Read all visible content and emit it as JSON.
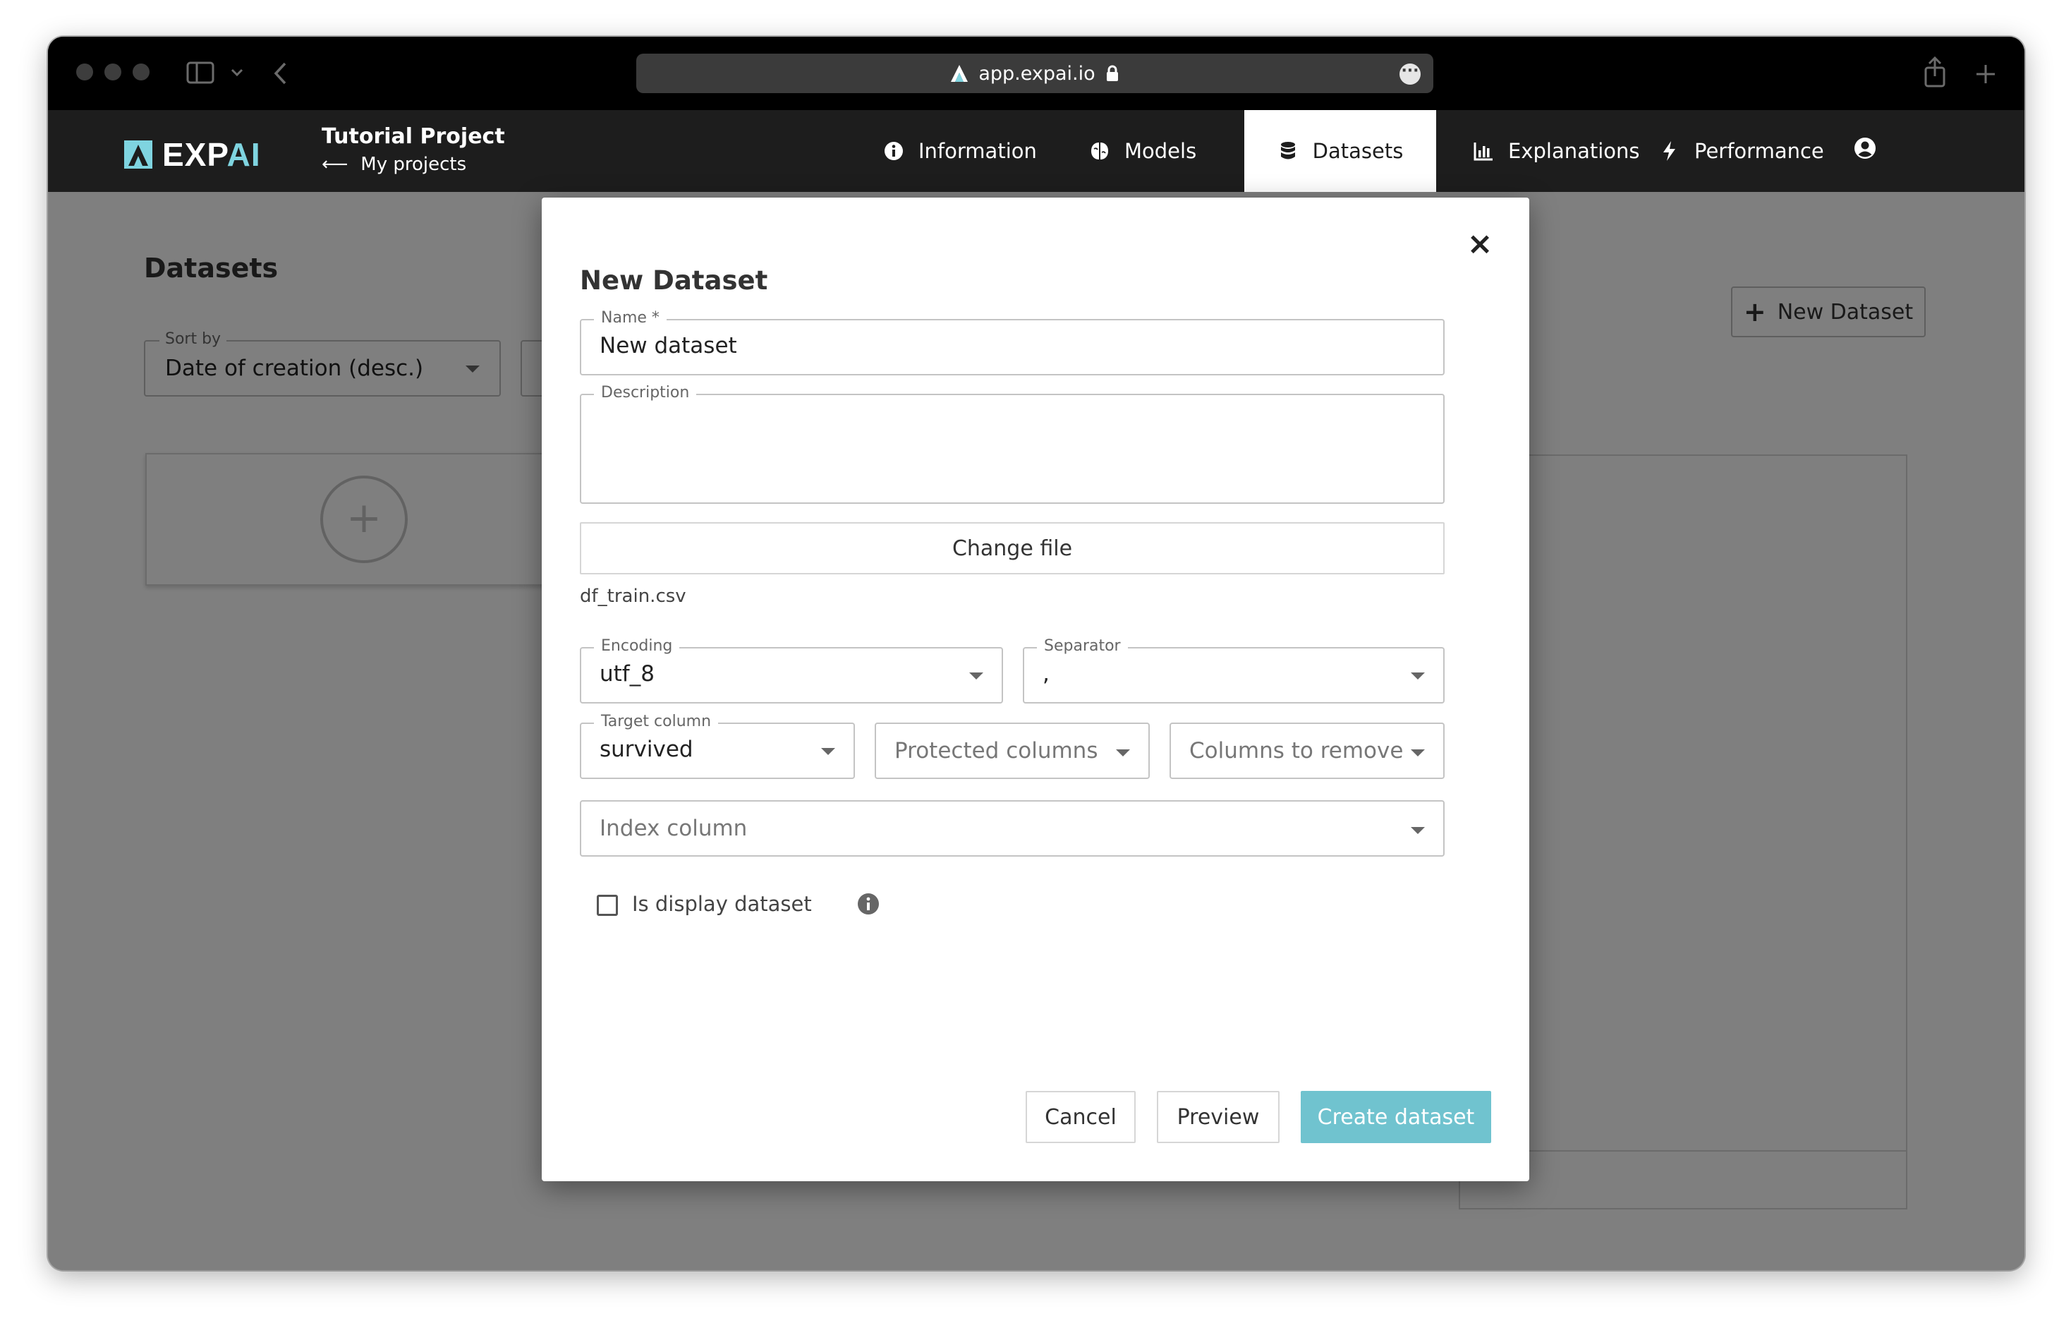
{
  "browser": {
    "url": "app.expai.io"
  },
  "header": {
    "logo_main": "EXP",
    "logo_ai": "AI",
    "project_title": "Tutorial Project",
    "back_label": "My projects",
    "nav": [
      {
        "label": "Information",
        "icon": "info-circle-icon",
        "active": false
      },
      {
        "label": "Models",
        "icon": "brain-icon",
        "active": false
      },
      {
        "label": "Datasets",
        "icon": "database-icon",
        "active": true
      },
      {
        "label": "Explanations",
        "icon": "bar-chart-icon",
        "active": false
      },
      {
        "label": "Performance",
        "icon": "lightning-icon",
        "active": false
      }
    ]
  },
  "page": {
    "title": "Datasets",
    "sort_label": "Sort by",
    "sort_value": "Date of creation (desc.)",
    "new_dataset_label": "New Dataset"
  },
  "modal": {
    "title": "New Dataset",
    "name_label": "Name *",
    "name_value": "New dataset",
    "description_label": "Description",
    "description_value": "",
    "change_file_label": "Change file",
    "file_name": "df_train.csv",
    "encoding_label": "Encoding",
    "encoding_value": "utf_8",
    "separator_label": "Separator",
    "separator_value": ",",
    "target_label": "Target column",
    "target_value": "survived",
    "protected_placeholder": "Protected columns",
    "remove_placeholder": "Columns to remove",
    "index_placeholder": "Index column",
    "display_label": "Is display dataset",
    "display_checked": false,
    "cancel_label": "Cancel",
    "preview_label": "Preview",
    "create_label": "Create dataset"
  },
  "colors": {
    "accent": "#70c3cf",
    "header_bg": "#1d1d1d",
    "logo_ai": "#7fd4e0"
  }
}
